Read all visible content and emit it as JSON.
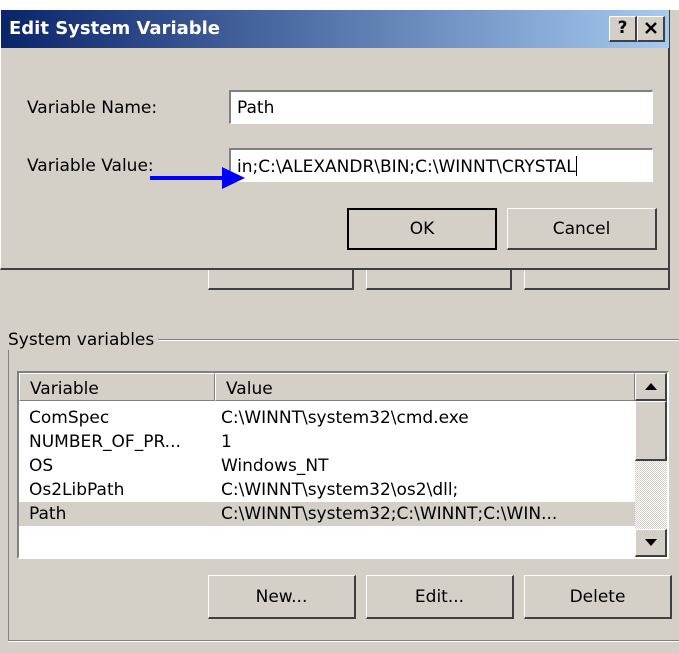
{
  "dialog": {
    "title": "Edit System Variable",
    "help_label": "?",
    "close_label": "×",
    "variable_name_label": "Variable Name:",
    "variable_name_value": "Path",
    "variable_value_label": "Variable Value:",
    "variable_value_value": "in;C:\\ALEXANDR\\BIN;C:\\WINNT\\CRYSTAL",
    "ok_label": "OK",
    "cancel_label": "Cancel"
  },
  "system_variables": {
    "group_label": "System variables",
    "columns": [
      "Variable",
      "Value"
    ],
    "rows": [
      {
        "variable": "ComSpec",
        "value": "C:\\WINNT\\system32\\cmd.exe"
      },
      {
        "variable": "NUMBER_OF_PR...",
        "value": "1"
      },
      {
        "variable": "OS",
        "value": "Windows_NT"
      },
      {
        "variable": "Os2LibPath",
        "value": "C:\\WINNT\\system32\\os2\\dll;"
      },
      {
        "variable": "Path",
        "value": "C:\\WINNT\\system32;C:\\WINNT;C:\\WIN..."
      }
    ],
    "selected_row": 4,
    "new_label": "New...",
    "edit_label": "Edit...",
    "delete_label": "Delete"
  },
  "colors": {
    "title_start": "#0a246a",
    "title_end": "#a6caf0",
    "face": "#d4d0c8",
    "annotation_arrow": "#0000ff"
  },
  "icons": {
    "scroll_up": "scroll-up-arrow-icon",
    "scroll_down": "scroll-down-arrow-icon",
    "annotation": "blue-arrow-icon"
  }
}
